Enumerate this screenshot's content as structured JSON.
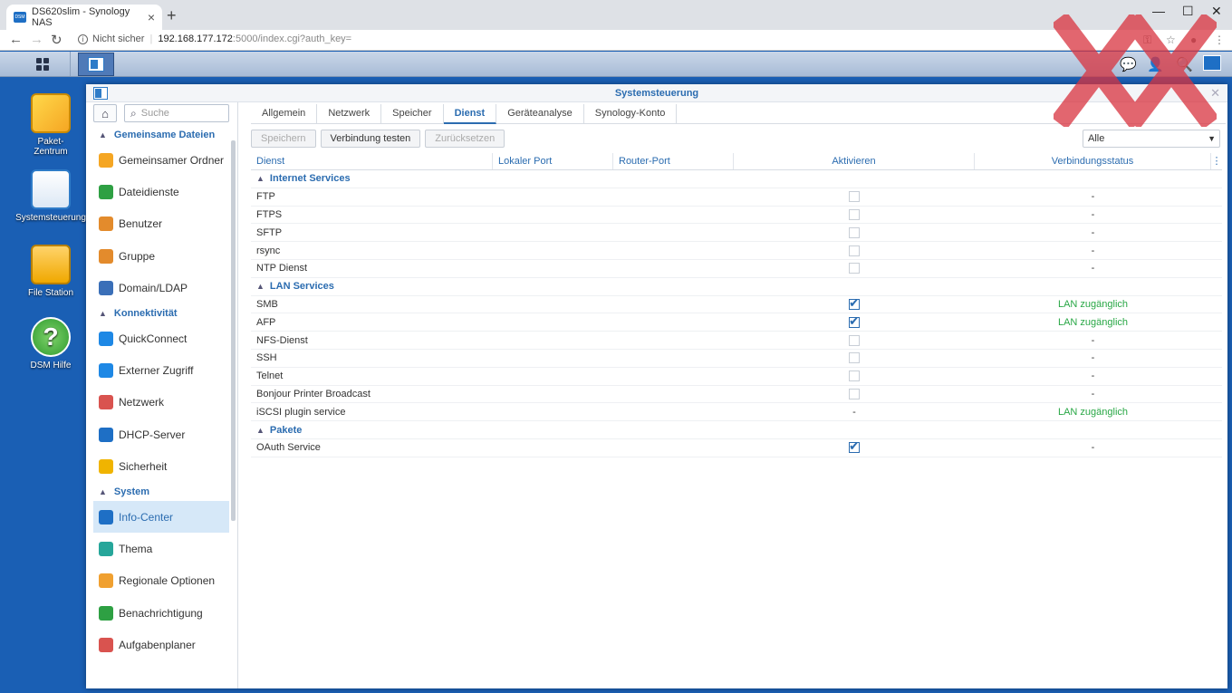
{
  "browser": {
    "tab_title": "DS620slim - Synology NAS",
    "favicon_text": "DSM",
    "new_tab": "+",
    "security_label": "Nicht sicher",
    "url_host": "192.168.177.172",
    "url_rest": ":5000/index.cgi?auth_key="
  },
  "desktop": {
    "icons": [
      {
        "label1": "Paket-",
        "label2": "Zentrum"
      },
      {
        "label1": "Systemsteuerung",
        "label2": ""
      },
      {
        "label1": "File Station",
        "label2": ""
      },
      {
        "label1": "DSM Hilfe",
        "label2": ""
      }
    ]
  },
  "window": {
    "title": "Systemsteuerung",
    "search_placeholder": "Suche"
  },
  "sidebar": {
    "groups": [
      {
        "label": "Gemeinsame Dateien",
        "items": [
          {
            "label": "Gemeinsamer Ordner",
            "color": "#f5a623"
          },
          {
            "label": "Dateidienste",
            "color": "#2ea043"
          },
          {
            "label": "Benutzer",
            "color": "#e38b2c"
          },
          {
            "label": "Gruppe",
            "color": "#e38b2c"
          },
          {
            "label": "Domain/LDAP",
            "color": "#3a6fb8"
          }
        ]
      },
      {
        "label": "Konnektivität",
        "items": [
          {
            "label": "QuickConnect",
            "color": "#1e88e5"
          },
          {
            "label": "Externer Zugriff",
            "color": "#1e88e5"
          },
          {
            "label": "Netzwerk",
            "color": "#d9534f"
          },
          {
            "label": "DHCP-Server",
            "color": "#1e6fc5"
          },
          {
            "label": "Sicherheit",
            "color": "#f0b400"
          }
        ]
      },
      {
        "label": "System",
        "items": [
          {
            "label": "Info-Center",
            "color": "#1e6fc5"
          },
          {
            "label": "Thema",
            "color": "#26a69a"
          },
          {
            "label": "Regionale Optionen",
            "color": "#f0a030"
          },
          {
            "label": "Benachrichtigung",
            "color": "#2ea043"
          },
          {
            "label": "Aufgabenplaner",
            "color": "#d9534f"
          }
        ]
      }
    ]
  },
  "tabs": [
    "Allgemein",
    "Netzwerk",
    "Speicher",
    "Dienst",
    "Geräteanalyse",
    "Synology-Konto"
  ],
  "active_tab": "Dienst",
  "toolbar": {
    "save": "Speichern",
    "test": "Verbindung testen",
    "reset": "Zurücksetzen",
    "filter": "Alle"
  },
  "columns": {
    "service": "Dienst",
    "local_port": "Lokaler Port",
    "router_port": "Router-Port",
    "enable": "Aktivieren",
    "status": "Verbindungsstatus"
  },
  "sections": [
    {
      "label": "Internet Services",
      "rows": [
        {
          "name": "FTP",
          "enabled": false,
          "enable_text": "",
          "status": "-"
        },
        {
          "name": "FTPS",
          "enabled": false,
          "enable_text": "",
          "status": "-"
        },
        {
          "name": "SFTP",
          "enabled": false,
          "enable_text": "",
          "status": "-"
        },
        {
          "name": "rsync",
          "enabled": false,
          "enable_text": "",
          "status": "-"
        },
        {
          "name": "NTP Dienst",
          "enabled": false,
          "enable_text": "",
          "status": "-"
        }
      ]
    },
    {
      "label": "LAN Services",
      "rows": [
        {
          "name": "SMB",
          "enabled": true,
          "enable_text": "",
          "status": "LAN zugänglich"
        },
        {
          "name": "AFP",
          "enabled": true,
          "enable_text": "",
          "status": "LAN zugänglich"
        },
        {
          "name": "NFS-Dienst",
          "enabled": false,
          "enable_text": "",
          "status": "-"
        },
        {
          "name": "SSH",
          "enabled": false,
          "enable_text": "",
          "status": "-"
        },
        {
          "name": "Telnet",
          "enabled": false,
          "enable_text": "",
          "status": "-"
        },
        {
          "name": "Bonjour Printer Broadcast",
          "enabled": false,
          "enable_text": "",
          "status": "-"
        },
        {
          "name": "iSCSI plugin service",
          "enabled": null,
          "enable_text": "-",
          "status": "LAN zugänglich"
        }
      ]
    },
    {
      "label": "Pakete",
      "rows": [
        {
          "name": "OAuth Service",
          "enabled": true,
          "enable_text": "",
          "status": "-"
        }
      ]
    }
  ],
  "colors": {
    "accent": "#2b6cb0",
    "ok": "#28a745"
  }
}
